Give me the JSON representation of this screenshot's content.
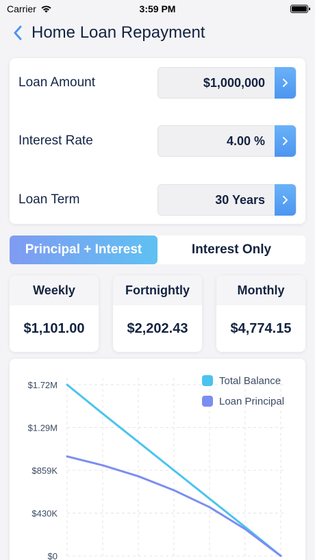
{
  "status": {
    "carrier": "Carrier",
    "time": "3:59 PM"
  },
  "nav": {
    "title": "Home Loan Repayment"
  },
  "inputs": [
    {
      "label": "Loan Amount",
      "value": "$1,000,000"
    },
    {
      "label": "Interest Rate",
      "value": "4.00 %"
    },
    {
      "label": "Loan Term",
      "value": "30 Years"
    }
  ],
  "segment": {
    "active": "Principal + Interest",
    "inactive": "Interest Only"
  },
  "payments": [
    {
      "label": "Weekly",
      "value": "$1,101.00"
    },
    {
      "label": "Fortnightly",
      "value": "$2,202.43"
    },
    {
      "label": "Monthly",
      "value": "$4,774.15"
    }
  ],
  "colors": {
    "accent": "#4c95f0",
    "total_balance": "#4ac3ef",
    "loan_principal": "#7b8ef0"
  },
  "chart_data": {
    "type": "line",
    "yticks": [
      "$1.72M",
      "$1.29M",
      "$859K",
      "$430K",
      "$0"
    ],
    "ylim": [
      0,
      1720000
    ],
    "xlim": [
      0,
      30
    ],
    "grid": true,
    "legend_position": "top-right",
    "series": [
      {
        "name": "Total Balance",
        "color": "#4ac3ef",
        "x": [
          0,
          5,
          10,
          15,
          20,
          25,
          30
        ],
        "values": [
          1720000,
          1430000,
          1145000,
          860000,
          575000,
          290000,
          0
        ]
      },
      {
        "name": "Loan Principal",
        "color": "#7b8ef0",
        "x": [
          0,
          5,
          10,
          15,
          20,
          25,
          30
        ],
        "values": [
          1000000,
          910000,
          800000,
          660000,
          490000,
          270000,
          0
        ]
      }
    ]
  }
}
